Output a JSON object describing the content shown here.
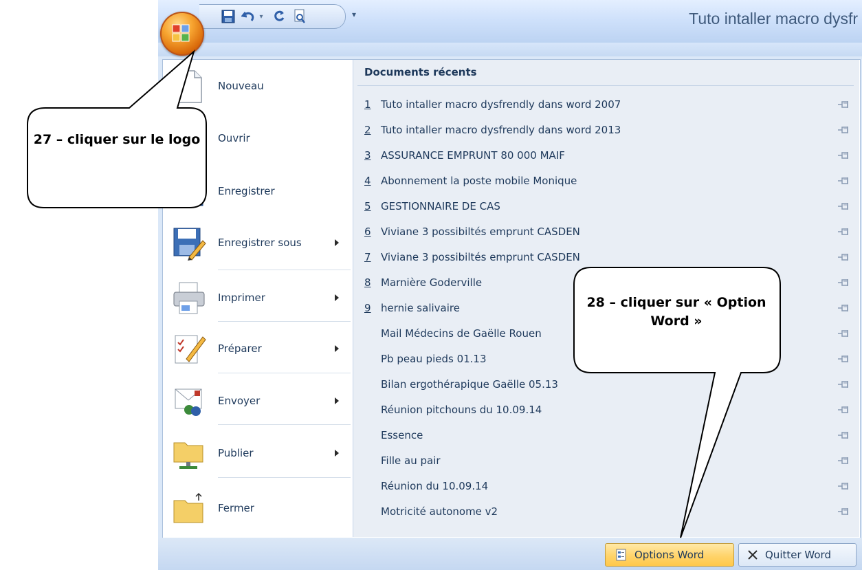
{
  "window": {
    "title": "Tuto intaller macro dysfr"
  },
  "qat": {
    "icons": [
      "save-icon",
      "undo-icon",
      "redo-icon",
      "print-preview-icon",
      "customize-qat-icon"
    ]
  },
  "menu": {
    "commands": [
      {
        "label": "Nouveau",
        "icon": "new-document-icon",
        "submenu": false
      },
      {
        "label": "Ouvrir",
        "icon": "open-folder-icon",
        "submenu": false
      },
      {
        "label": "Enregistrer",
        "icon": "save-icon",
        "submenu": false
      },
      {
        "label": "Enregistrer sous",
        "icon": "save-as-icon",
        "submenu": true
      },
      {
        "label": "Imprimer",
        "icon": "printer-icon",
        "submenu": true
      },
      {
        "label": "Préparer",
        "icon": "prepare-document-icon",
        "submenu": true
      },
      {
        "label": "Envoyer",
        "icon": "send-icon",
        "submenu": true
      },
      {
        "label": "Publier",
        "icon": "publish-icon",
        "submenu": true
      },
      {
        "label": "Fermer",
        "icon": "close-folder-icon",
        "submenu": false
      }
    ],
    "recent_title": "Documents récents",
    "recent_docs": [
      {
        "num": "1",
        "name": "Tuto intaller macro dysfrendly dans word 2007"
      },
      {
        "num": "2",
        "name": "Tuto intaller macro dysfrendly dans word 2013"
      },
      {
        "num": "3",
        "name": "ASSURANCE EMPRUNT 80 000 MAIF"
      },
      {
        "num": "4",
        "name": "Abonnement la poste mobile Monique"
      },
      {
        "num": "5",
        "name": "GESTIONNAIRE DE CAS"
      },
      {
        "num": "6",
        "name": "Viviane 3 possibiltés emprunt CASDEN"
      },
      {
        "num": "7",
        "name": "Viviane 3 possibiltés emprunt CASDEN"
      },
      {
        "num": "8",
        "name": "Marnière Goderville"
      },
      {
        "num": "9",
        "name": "hernie salivaire"
      },
      {
        "num": "",
        "name": "Mail Médecins de Gaëlle Rouen"
      },
      {
        "num": "",
        "name": "Pb peau pieds 01.13"
      },
      {
        "num": "",
        "name": "Bilan ergothérapique Gaëlle 05.13"
      },
      {
        "num": "",
        "name": "Réunion pitchouns du 10.09.14"
      },
      {
        "num": "",
        "name": "Essence"
      },
      {
        "num": "",
        "name": "Fille au pair"
      },
      {
        "num": "",
        "name": "Réunion du 10.09.14"
      },
      {
        "num": "",
        "name": "Motricité autonome v2"
      }
    ],
    "options_button": "Options Word",
    "quit_button": "Quitter Word"
  },
  "callouts": [
    {
      "text": "27 – cliquer sur le logo"
    },
    {
      "text": "28 – cliquer sur « Option Word »"
    }
  ],
  "colors": {
    "accent": "#1e395b",
    "highlight": "#ffd46b",
    "menu_bg": "#dbe8f8"
  }
}
